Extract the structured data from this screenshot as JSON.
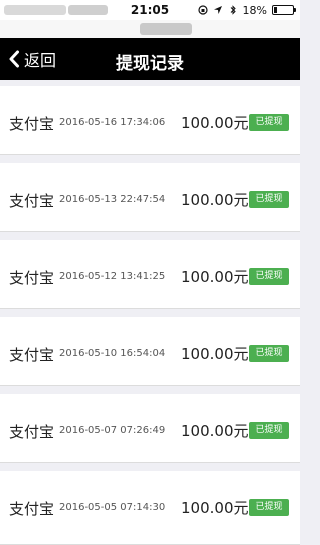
{
  "status_bar": {
    "time": "21:05",
    "battery": "18%",
    "battery_level": 0.18
  },
  "nav": {
    "back_label": "返回",
    "title": "提现记录"
  },
  "records": [
    {
      "method": "支付宝",
      "time": "2016-05-16 17:34:06",
      "amount": "100.00元",
      "status": "已提现"
    },
    {
      "method": "支付宝",
      "time": "2016-05-13 22:47:54",
      "amount": "100.00元",
      "status": "已提现"
    },
    {
      "method": "支付宝",
      "time": "2016-05-12 13:41:25",
      "amount": "100.00元",
      "status": "已提现"
    },
    {
      "method": "支付宝",
      "time": "2016-05-10 16:54:04",
      "amount": "100.00元",
      "status": "已提现"
    },
    {
      "method": "支付宝",
      "time": "2016-05-07 07:26:49",
      "amount": "100.00元",
      "status": "已提现"
    },
    {
      "method": "支付宝",
      "time": "2016-05-05 07:14:30",
      "amount": "100.00元",
      "status": "已提现"
    }
  ],
  "colors": {
    "navbar": "#000000",
    "badge": "#4caf50",
    "background": "#efeff4"
  }
}
